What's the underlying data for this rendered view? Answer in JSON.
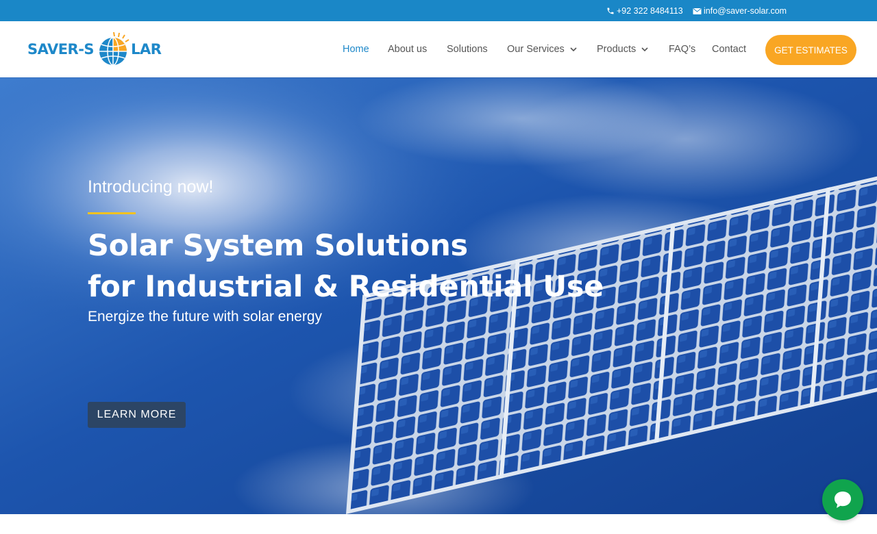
{
  "topbar": {
    "phone": "+92 322 8484113",
    "email": "info@saver-solar.com",
    "phone_icon": "phone-icon",
    "email_icon": "envelope-icon",
    "background": "#1a87c7"
  },
  "header": {
    "logo": {
      "text_left": "SAVER-S",
      "text_right": "LAR",
      "icon": "solar-globe-logo"
    },
    "nav": [
      {
        "label": "Home",
        "active": true
      },
      {
        "label": "About us"
      },
      {
        "label": "Solutions"
      },
      {
        "label": "Our Services",
        "has_dropdown": true
      },
      {
        "label": "Products",
        "has_dropdown": true
      },
      {
        "label": "FAQ’s"
      },
      {
        "label": "Contact"
      }
    ],
    "dropdown_icon": "chevron-down-icon",
    "cta_label": "GET ESTIMATES"
  },
  "hero": {
    "intro": "Introducing now!",
    "headline_line1": "Solar System Solutions",
    "headline_line2": "for Industrial & Residential Use",
    "tagline": "Energize the future with solar energy",
    "button_label": "LEARN MORE"
  },
  "chat": {
    "icon": "chat-bubble-icon"
  },
  "colors": {
    "brand_blue": "#1e88c9",
    "accent_orange": "#f9a623",
    "accent_yellow": "#f3c21f",
    "button_dark": "#2c4565",
    "chat_green": "#10a44d"
  }
}
